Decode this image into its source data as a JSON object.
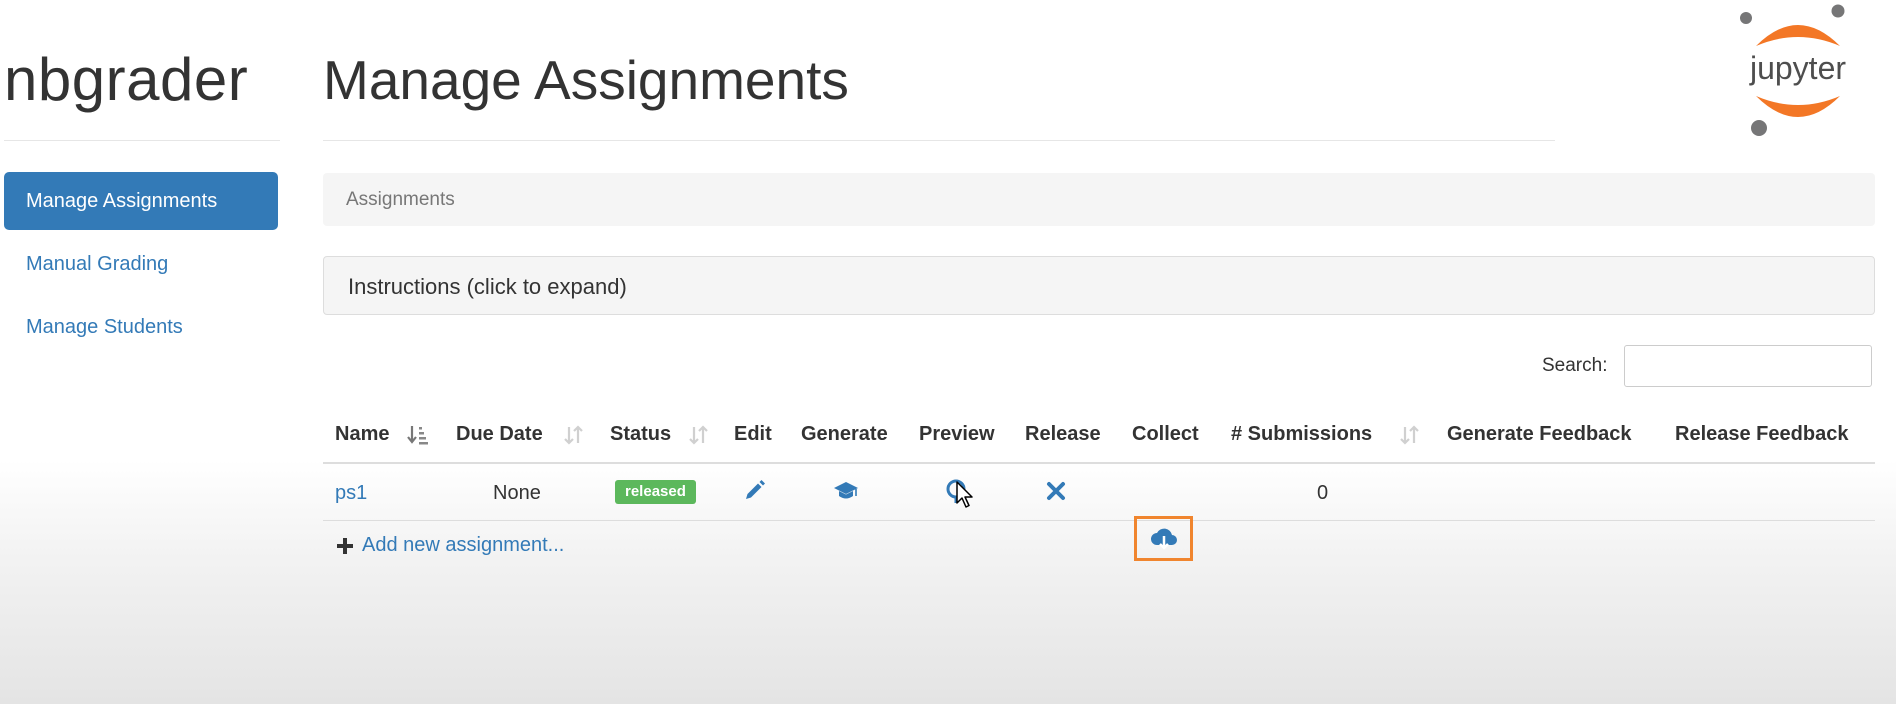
{
  "brand": "nbgrader",
  "logo_text": "jupyter",
  "sidebar": {
    "items": [
      {
        "label": "Manage Assignments",
        "active": true
      },
      {
        "label": "Manual Grading",
        "active": false
      },
      {
        "label": "Manage Students",
        "active": false
      }
    ]
  },
  "header": {
    "title": "Manage Assignments"
  },
  "breadcrumb": {
    "label": "Assignments"
  },
  "instructions": {
    "label": "Instructions (click to expand)"
  },
  "search": {
    "label": "Search:",
    "value": ""
  },
  "table": {
    "columns": [
      {
        "label": "Name",
        "sortable": true
      },
      {
        "label": "Due Date",
        "sortable": true
      },
      {
        "label": "Status",
        "sortable": true
      },
      {
        "label": "Edit",
        "sortable": false
      },
      {
        "label": "Generate",
        "sortable": false
      },
      {
        "label": "Preview",
        "sortable": false
      },
      {
        "label": "Release",
        "sortable": false
      },
      {
        "label": "Collect",
        "sortable": false
      },
      {
        "label": "# Submissions",
        "sortable": true
      },
      {
        "label": "Generate Feedback",
        "sortable": false
      },
      {
        "label": "Release Feedback",
        "sortable": false
      }
    ],
    "rows": [
      {
        "name": "ps1",
        "due_date": "None",
        "status": "released",
        "edit_icon": "pencil-icon",
        "generate_icon": "graduation-cap-icon",
        "preview_icon": "search-icon",
        "release_icon": "x-icon",
        "collect_icon": "cloud-download-icon",
        "submissions": "0"
      }
    ]
  },
  "add_assignment": {
    "label": "Add new assignment..."
  },
  "colors": {
    "primary": "#337ab7",
    "success": "#5cb85c",
    "highlight": "#f0852e",
    "logo_orange": "#f37726"
  }
}
